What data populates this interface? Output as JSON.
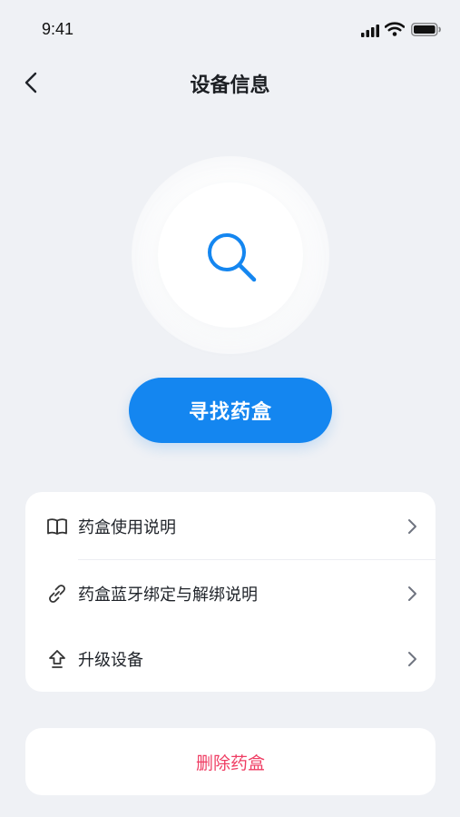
{
  "status_bar": {
    "time": "9:41"
  },
  "nav": {
    "title": "设备信息"
  },
  "actions": {
    "find_label": "寻找药盒"
  },
  "menu": {
    "items": [
      {
        "label": "药盒使用说明",
        "icon": "book-icon"
      },
      {
        "label": "药盒蓝牙绑定与解绑说明",
        "icon": "link-icon"
      },
      {
        "label": "升级设备",
        "icon": "upgrade-arrow-icon"
      }
    ]
  },
  "delete": {
    "label": "删除药盒"
  },
  "colors": {
    "accent": "#1486f0",
    "danger": "#ef3d63",
    "background": "#eff1f5"
  }
}
